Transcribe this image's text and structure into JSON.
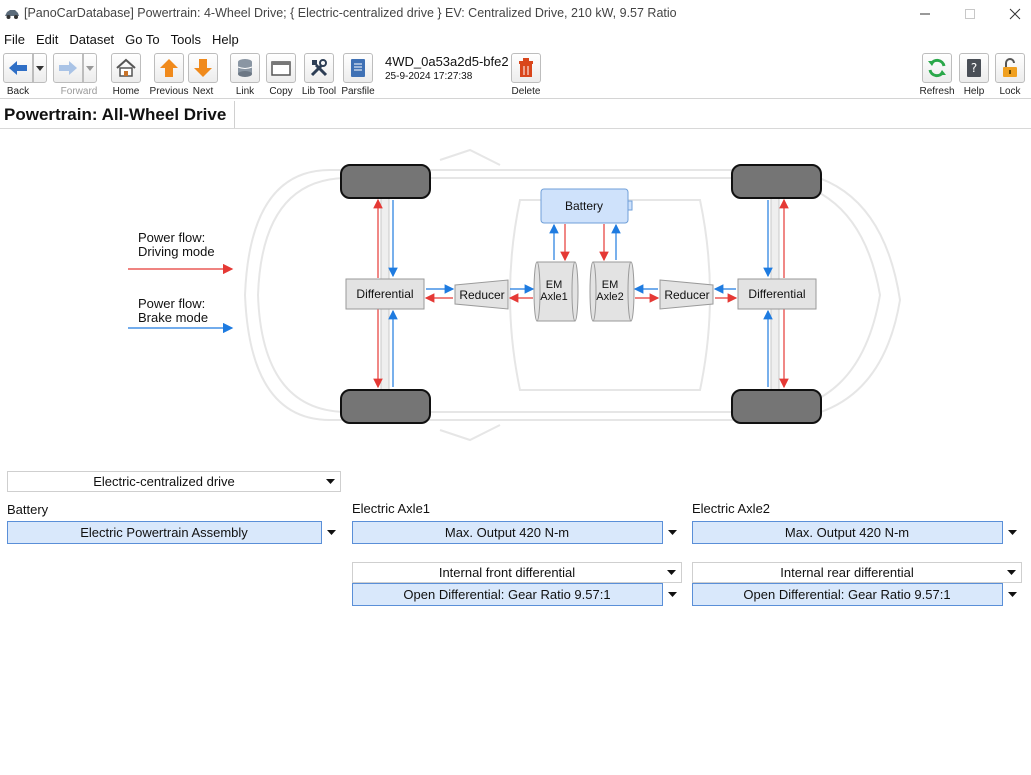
{
  "window": {
    "title": "[PanoCarDatabase] Powertrain: 4-Wheel Drive; { Electric-centralized drive } EV: Centralized Drive, 210 kW, 9.57 Ratio"
  },
  "menu": [
    "File",
    "Edit",
    "Dataset",
    "Go To",
    "Tools",
    "Help"
  ],
  "toolbar": {
    "back": "Back",
    "forward": "Forward",
    "home": "Home",
    "previous": "Previous",
    "next": "Next",
    "link": "Link",
    "copy": "Copy",
    "lib_tool": "Lib Tool",
    "parsfile": "Parsfile",
    "record_id": "4WD_0a53a2d5-bfe2",
    "record_date": "25-9-2024 17:27:38",
    "delete": "Delete",
    "refresh": "Refresh",
    "help": "Help",
    "lock": "Lock"
  },
  "page": {
    "title": "Powertrain: All-Wheel Drive"
  },
  "diagram": {
    "legend_driving_1": "Power flow:",
    "legend_driving_2": "Driving mode",
    "legend_brake_1": "Power flow:",
    "legend_brake_2": "Brake mode",
    "battery": "Battery",
    "differential_front": "Differential",
    "differential_rear": "Differential",
    "reducer_front": "Reducer",
    "reducer_rear": "Reducer",
    "em1_line1": "EM",
    "em1_line2": "Axle1",
    "em2_line1": "EM",
    "em2_line2": "Axle2",
    "colors": {
      "driving": "#e53935",
      "brake": "#1e7be0",
      "battery_fill": "#cfe2fb",
      "tire": "#757575"
    }
  },
  "form": {
    "drive_type": "Electric-centralized drive",
    "battery_label": "Battery",
    "battery_value": "Electric Powertrain Assembly",
    "axle1_label": "Electric Axle1",
    "axle1_value": "Max. Output 420 N-m",
    "axle2_label": "Electric Axle2",
    "axle2_value": "Max. Output 420 N-m",
    "front_diff_type": "Internal front differential",
    "front_diff_value": "Open Differential: Gear Ratio 9.57:1",
    "rear_diff_type": "Internal rear differential",
    "rear_diff_value": "Open Differential: Gear Ratio 9.57:1"
  }
}
